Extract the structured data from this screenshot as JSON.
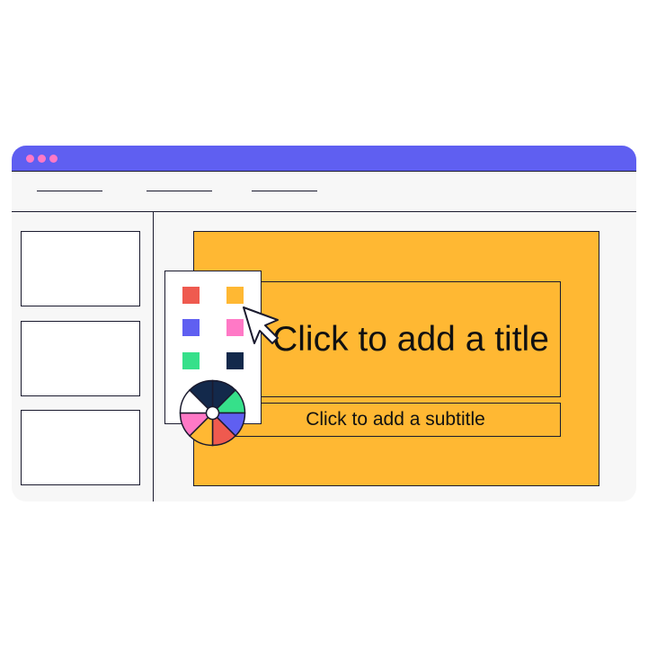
{
  "window": {
    "titlebar_color": "#5f5ff1",
    "window_controls": [
      "dot-1",
      "dot-2",
      "dot-3"
    ],
    "control_color": "#ff79c6"
  },
  "menu": {
    "items": [
      "menu-placeholder-1",
      "menu-placeholder-2",
      "menu-placeholder-3"
    ]
  },
  "sidebar": {
    "thumbnails": [
      "slide-thumbnail-1",
      "slide-thumbnail-2",
      "slide-thumbnail-3"
    ]
  },
  "slide": {
    "background_color": "#ffb833",
    "title_placeholder": "Click to add a title",
    "subtitle_placeholder": "Click to add a subtitle"
  },
  "color_palette": {
    "swatches": [
      "#ef5a4f",
      "#ffb833",
      "#5f5ff1",
      "#ff79c6",
      "#36e08a",
      "#13294b"
    ],
    "wheel_colors": [
      "#13294b",
      "#36e08a",
      "#5f5ff1",
      "#ef5a4f",
      "#ffb833",
      "#ff79c6",
      "#ffffff"
    ]
  },
  "cursor": {
    "icon": "arrow-cursor-icon"
  }
}
